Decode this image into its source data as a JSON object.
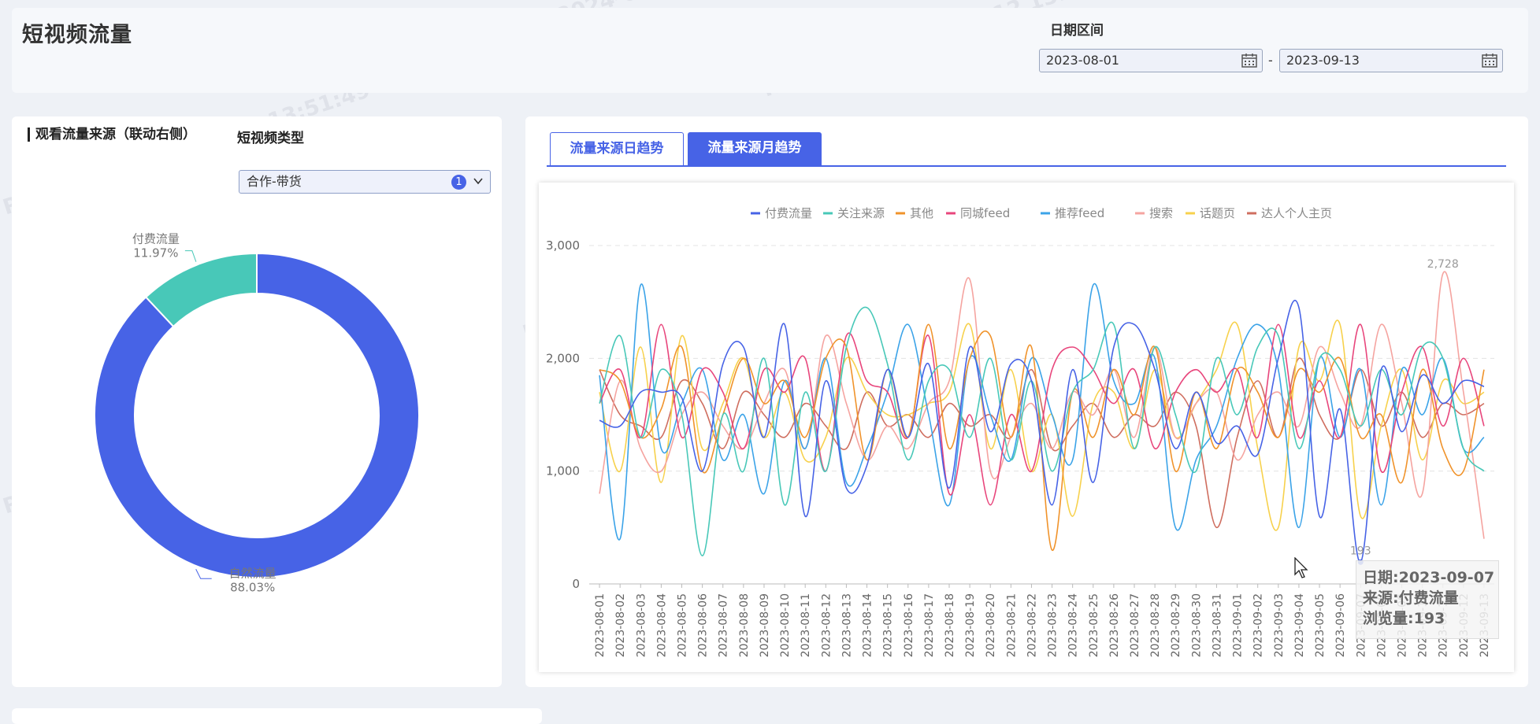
{
  "header": {
    "title": "短视频流量",
    "date_range_label": "日期区间",
    "date_start": "2023-08-01",
    "date_end": "2023-09-13",
    "date_separator": "-"
  },
  "left_panel": {
    "title": "观看流量来源（联动右侧）",
    "filter_label": "短视频类型",
    "filter_value": "合作-带货",
    "filter_count": "1",
    "donut": {
      "segments": [
        {
          "name": "自然流量",
          "percent_label": "88.03%",
          "value": 88.03,
          "color": "#4763e6"
        },
        {
          "name": "付费流量",
          "percent_label": "11.97%",
          "value": 11.97,
          "color": "#48c8b8"
        }
      ]
    }
  },
  "right_panel": {
    "tabs": [
      {
        "label": "流量来源日趋势",
        "active": false
      },
      {
        "label": "流量来源月趋势",
        "active": true
      }
    ]
  },
  "chart_data": {
    "type": "line",
    "ylim": [
      0,
      3000
    ],
    "y_ticks": [
      "0",
      "1,000",
      "2,000",
      "3,000"
    ],
    "x": [
      "2023-08-01",
      "2023-08-02",
      "2023-08-03",
      "2023-08-04",
      "2023-08-05",
      "2023-08-06",
      "2023-08-07",
      "2023-08-08",
      "2023-08-09",
      "2023-08-10",
      "2023-08-11",
      "2023-08-12",
      "2023-08-13",
      "2023-08-14",
      "2023-08-15",
      "2023-08-16",
      "2023-08-17",
      "2023-08-18",
      "2023-08-19",
      "2023-08-20",
      "2023-08-21",
      "2023-08-22",
      "2023-08-23",
      "2023-08-24",
      "2023-08-25",
      "2023-08-26",
      "2023-08-27",
      "2023-08-28",
      "2023-08-29",
      "2023-08-30",
      "2023-08-31",
      "2023-09-01",
      "2023-09-02",
      "2023-09-03",
      "2023-09-04",
      "2023-09-05",
      "2023-09-06",
      "2023-09-07",
      "2023-09-08",
      "2023-09-09",
      "2023-09-10",
      "2023-09-11",
      "2023-09-12",
      "2023-09-13"
    ],
    "series": [
      {
        "name": "付费流量",
        "color": "#4763e6",
        "values": [
          1450,
          1400,
          1700,
          1700,
          1650,
          1000,
          1950,
          2100,
          1300,
          2300,
          600,
          1800,
          850,
          1050,
          1900,
          1300,
          1950,
          850,
          2100,
          1350,
          1950,
          1800,
          700,
          1900,
          900,
          2100,
          2300,
          1900,
          1200,
          1700,
          1250,
          1400,
          1150,
          2000,
          2450,
          600,
          1550,
          193,
          1900,
          1350,
          1850,
          1600,
          1800,
          1750
        ]
      },
      {
        "name": "关注来源",
        "color": "#48c8b8",
        "values": [
          1600,
          2200,
          1300,
          1900,
          1500,
          250,
          1500,
          1000,
          2000,
          700,
          1700,
          1000,
          2100,
          2450,
          1950,
          1100,
          1800,
          1900,
          1300,
          2000,
          1100,
          1800,
          1000,
          1700,
          1900,
          2300,
          1200,
          2100,
          1500,
          1000,
          2000,
          1500,
          2100,
          2200,
          1200,
          2000,
          1900,
          1400,
          1900,
          1500,
          2100,
          2000,
          1200,
          1000
        ]
      },
      {
        "name": "其他",
        "color": "#f0932b",
        "values": [
          1900,
          1800,
          1300,
          1550,
          2100,
          1000,
          1500,
          2000,
          1600,
          1800,
          1300,
          2000,
          2100,
          1100,
          1900,
          1300,
          2300,
          1200,
          2000,
          2200,
          1300,
          2100,
          300,
          1700,
          1300,
          1900,
          1500,
          2100,
          1000,
          1700,
          1200,
          1900,
          1700,
          1300,
          1900,
          1700,
          2000,
          1300,
          1500,
          900,
          1900,
          1200,
          1000,
          1900
        ]
      },
      {
        "name": "同城feed",
        "color": "#e8467c",
        "values": [
          1600,
          1900,
          1300,
          2300,
          1300,
          1900,
          1700,
          1200,
          1900,
          1700,
          2000,
          1000,
          2200,
          1800,
          1700,
          1300,
          2200,
          800,
          1500,
          700,
          1500,
          1000,
          1900,
          2100,
          1900,
          1600,
          1900,
          1200,
          1700,
          1900,
          1700,
          1900,
          1300,
          2300,
          1300,
          1800,
          1300,
          2300,
          1000,
          1700,
          2100,
          1400,
          2000,
          1400
        ]
      },
      {
        "name": "推荐feed",
        "color": "#3ba3e8",
        "values": [
          1850,
          400,
          2650,
          1200,
          1600,
          1900,
          1100,
          1500,
          800,
          1800,
          1200,
          2000,
          900,
          1200,
          1700,
          2300,
          1500,
          700,
          2000,
          1500,
          1100,
          2000,
          1500,
          1100,
          2650,
          1800,
          1600,
          2000,
          500,
          1100,
          1400,
          2000,
          2300,
          1900,
          500,
          2000,
          1300,
          1900,
          700,
          1900,
          1500,
          2000,
          1200,
          1300
        ]
      },
      {
        "name": "搜索",
        "color": "#f5a4a0",
        "values": [
          800,
          1800,
          1200,
          1000,
          1500,
          1700,
          1400,
          1200,
          1600,
          1900,
          1200,
          2200,
          1600,
          1100,
          1400,
          1200,
          1600,
          1800,
          2700,
          1000,
          1300,
          1600,
          1200,
          1700,
          1500,
          1900,
          1300,
          2100,
          1300,
          1600,
          1700,
          1100,
          1500,
          1700,
          1400,
          2100,
          1700,
          1400,
          2300,
          1600,
          800,
          2750,
          1700,
          400
        ]
      },
      {
        "name": "话题页",
        "color": "#f7d14c",
        "values": [
          1700,
          1000,
          2100,
          900,
          2200,
          1200,
          1600,
          2000,
          1300,
          1700,
          1100,
          1300,
          2000,
          1700,
          1500,
          1500,
          1600,
          1700,
          2300,
          1200,
          1900,
          1000,
          1500,
          600,
          1600,
          1700,
          1200,
          1900,
          1300,
          1600,
          1900,
          2300,
          1200,
          500,
          2100,
          1800,
          2300,
          600,
          1400,
          1900,
          1100,
          1800,
          1600,
          1700
        ]
      },
      {
        "name": "达人个人主页",
        "color": "#cf6e5f",
        "values": [
          1900,
          1500,
          1400,
          1300,
          1800,
          1600,
          1200,
          1700,
          1500,
          1300,
          1600,
          1400,
          1200,
          1700,
          1400,
          1500,
          1300,
          1600,
          1400,
          1500,
          1300,
          1900,
          1200,
          1400,
          1600,
          1300,
          1500,
          1400,
          1700,
          1400,
          500,
          1300,
          1800,
          1300,
          2000,
          1500,
          1300,
          1900,
          1400,
          1700,
          1300,
          1600,
          1500,
          1600
        ]
      }
    ],
    "label_max": "2,728",
    "label_min": "193"
  },
  "tooltip": {
    "date_line": "日期:2023-09-07",
    "source_line": "来源:付费流量",
    "views_line": "浏览量:193"
  },
  "watermark": "Ruohong.Li2024-06-12 13:51:49"
}
